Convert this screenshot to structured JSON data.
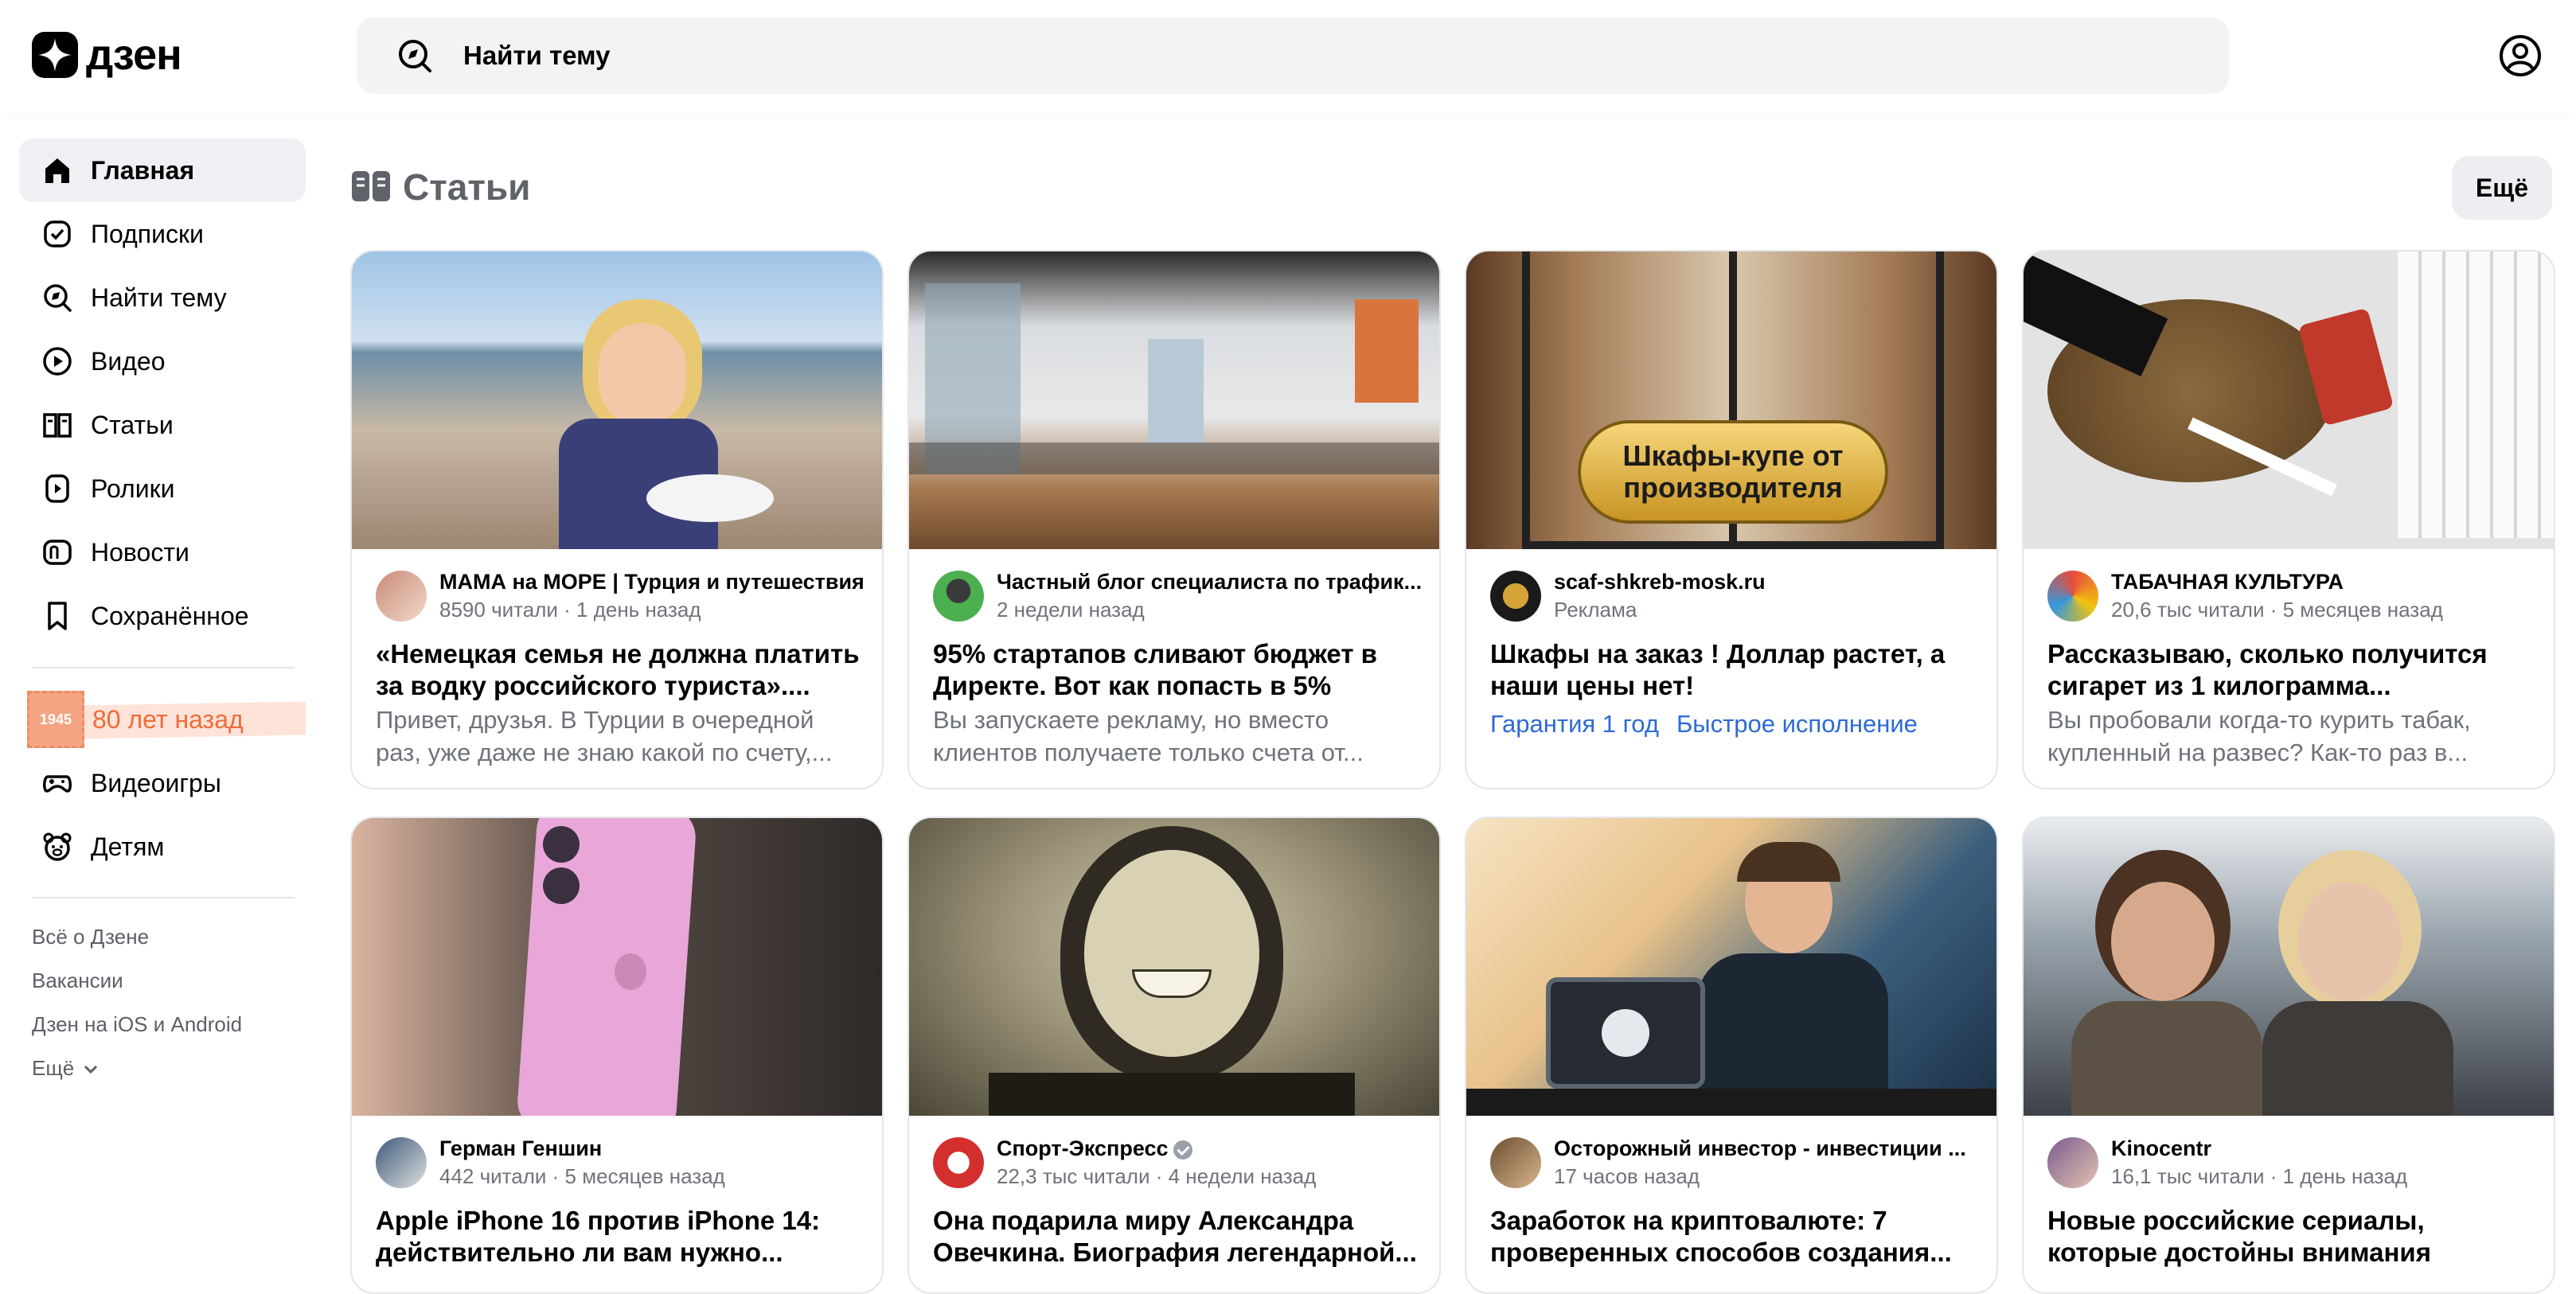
{
  "header": {
    "logo_text": "дзен",
    "search_placeholder": "Найти тему"
  },
  "sidebar": {
    "items": [
      {
        "label": "Главная",
        "icon": "home-icon",
        "active": true
      },
      {
        "label": "Подписки",
        "icon": "subscriptions-icon"
      },
      {
        "label": "Найти тему",
        "icon": "compass-icon"
      },
      {
        "label": "Видео",
        "icon": "play-icon"
      },
      {
        "label": "Статьи",
        "icon": "book-icon"
      },
      {
        "label": "Ролики",
        "icon": "shorts-icon"
      },
      {
        "label": "Новости",
        "icon": "news-icon"
      },
      {
        "label": "Сохранённое",
        "icon": "bookmark-icon"
      }
    ],
    "promo": {
      "label": "80 лет назад",
      "stamp": "1945",
      "color": "#ef6b3a"
    },
    "items2": [
      {
        "label": "Видеоигры",
        "icon": "gamepad-icon"
      },
      {
        "label": "Детям",
        "icon": "bear-icon"
      }
    ],
    "footer": [
      "Всё о Дзене",
      "Вакансии",
      "Дзен на iOS и Android",
      "Ещё"
    ]
  },
  "main": {
    "section_title": "Статьи",
    "more_button": "Ещё",
    "cards": [
      {
        "channel": "МАМА на МОРЕ | Турция и путешествия",
        "sub": "8590 читали · 1 день назад",
        "title": "«Немецкая семья не должна платить за водку российского туриста»....",
        "snippet": "Привет, друзья. В Турции в очередной раз, уже даже не знаю какой по счету,..."
      },
      {
        "channel": "Частный блог специалиста по трафик...",
        "sub": "2 недели назад",
        "title": "95% стартапов сливают бюджет в Директе. Вот как попасть в 5%",
        "snippet": "Вы запускаете рекламу, но вместо клиентов получаете только счета от..."
      },
      {
        "channel": "scaf-shkreb-mosk.ru",
        "sub": "Реклама",
        "title": "Шкафы на заказ ! Доллар растет, а наши цены нет!",
        "banner": "Шкафы-купе от производителя",
        "links": [
          "Гарантия 1 год",
          "Быстрое исполнение"
        ]
      },
      {
        "channel": "ТАБАЧНАЯ КУЛЬТУРА",
        "sub": "20,6 тыс читали · 5 месяцев назад",
        "title": "Рассказываю, сколько получится сигарет из 1 килограмма...",
        "snippet": "Вы пробовали когда-то курить табак, купленный на развес? Как-то раз в..."
      },
      {
        "channel": "Герман Геншин",
        "sub": "442 читали · 5 месяцев назад",
        "title": "Apple iPhone 16 против iPhone 14: действительно ли вам нужно..."
      },
      {
        "channel": "Спорт-Экспресс",
        "sub": "22,3 тыс читали · 4 недели назад",
        "title": "Она подарила миру Александра Овечкина. Биография легендарной..."
      },
      {
        "channel": "Осторожный инвестор - инвестиции ...",
        "sub": "17 часов назад",
        "title": "Заработок на криптовалюте: 7 проверенных способов создания..."
      },
      {
        "channel": "Kinocentr",
        "sub": "16,1 тыс читали · 1 день назад",
        "title": "Новые российские сериалы, которые достойны внимания"
      }
    ]
  }
}
